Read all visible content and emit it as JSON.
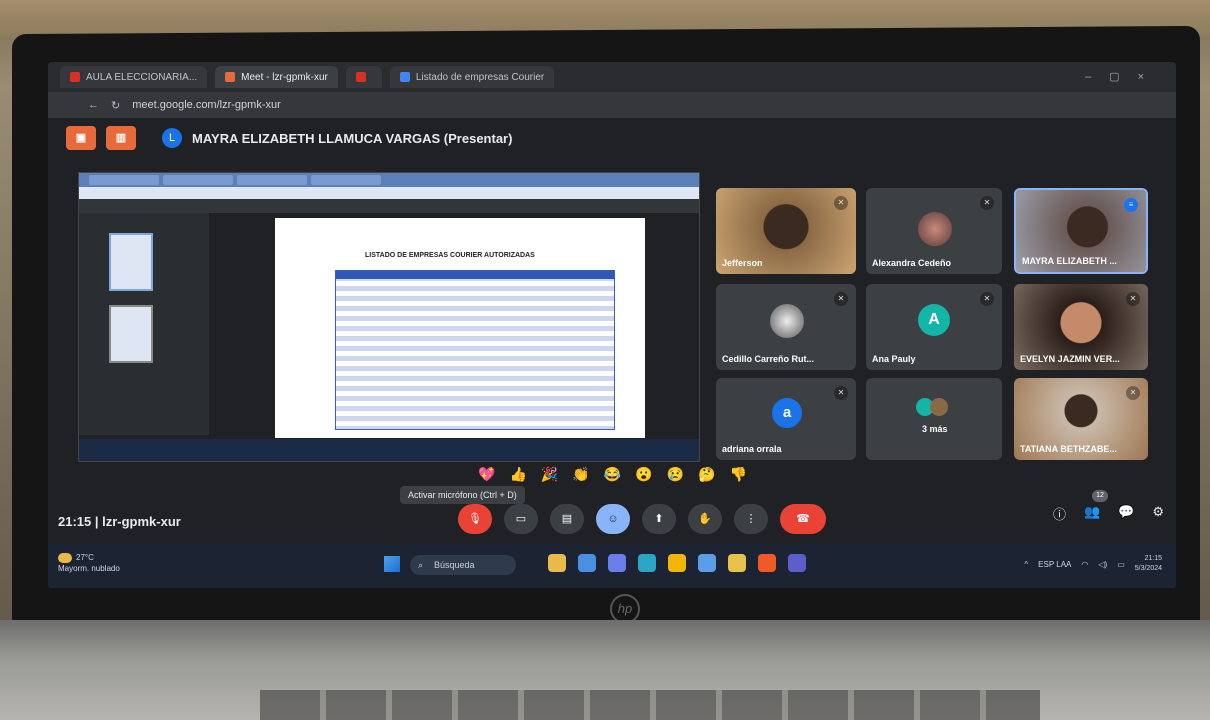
{
  "browser": {
    "tabs": [
      {
        "label": "AULA ELECCIONARIA...",
        "color": "#d93025"
      },
      {
        "label": "Meet - lzr-gpmk-xur",
        "color": "#e86a3a"
      },
      {
        "label": "",
        "color": "#d93025"
      },
      {
        "label": "Listado de empresas Courier",
        "color": "#4285f4"
      }
    ],
    "url": "meet.google.com/lzr-gpmk-xur",
    "window_controls": "–▢×"
  },
  "meet": {
    "presenter_initial": "L",
    "presenter_label": "MAYRA ELIZABETH LLAMUCA VARGAS (Presentar)",
    "header_btn_1": "▣",
    "header_btn_2": "▥",
    "meeting_code": "21:15  |  lzr-gpmk-xur",
    "shared_doc_title": "LISTADO DE EMPRESAS COURIER AUTORIZADAS",
    "tooltip": "Activar micrófono (Ctrl + D)",
    "participants_badge": "12",
    "reactions": [
      "💖",
      "👍",
      "🎉",
      "👏",
      "😂",
      "😮",
      "😢",
      "🤔",
      "👎"
    ],
    "controls": [
      {
        "name": "mic-button",
        "icon": "🎙",
        "style": "red"
      },
      {
        "name": "camera-button",
        "icon": "▭",
        "style": ""
      },
      {
        "name": "captions-button",
        "icon": "▤",
        "style": ""
      },
      {
        "name": "emoji-button",
        "icon": "☺",
        "style": "blue"
      },
      {
        "name": "present-button",
        "icon": "⬆",
        "style": ""
      },
      {
        "name": "raise-hand-button",
        "icon": "✋",
        "style": ""
      },
      {
        "name": "more-options-button",
        "icon": "⋮",
        "style": ""
      },
      {
        "name": "leave-call-button",
        "icon": "☎",
        "style": "end"
      }
    ],
    "right_controls": [
      "ⓘ",
      "👥",
      "💬",
      "⚙"
    ],
    "participants": [
      {
        "name": "Jefferson",
        "type": "video",
        "muted": true
      },
      {
        "name": "Alexandra Cedeño",
        "type": "photo",
        "muted": true
      },
      {
        "name": "MAYRA ELIZABETH ...",
        "type": "video",
        "muted": false
      },
      {
        "name": "Cedillo Carreño Rut...",
        "type": "photo",
        "muted": true
      },
      {
        "name": "Ana Pauly",
        "type": "initial",
        "initial": "A",
        "color": "#12b5a6",
        "muted": true
      },
      {
        "name": "EVELYN JAZMIN VER...",
        "type": "video",
        "muted": true
      },
      {
        "name": "adriana orrala",
        "type": "initial",
        "initial": "a",
        "color": "#1a73e8",
        "muted": true
      },
      {
        "name": "3 más",
        "type": "more",
        "muted": false
      },
      {
        "name": "TATIANA BETHZABE...",
        "type": "video",
        "muted": true
      }
    ]
  },
  "taskbar": {
    "weather_temp": "27°C",
    "weather_desc": "Mayorm. nublado",
    "search_label": "Búsqueda",
    "lang": "ESP LAA",
    "time": "21:15",
    "date": "5/3/2024"
  }
}
